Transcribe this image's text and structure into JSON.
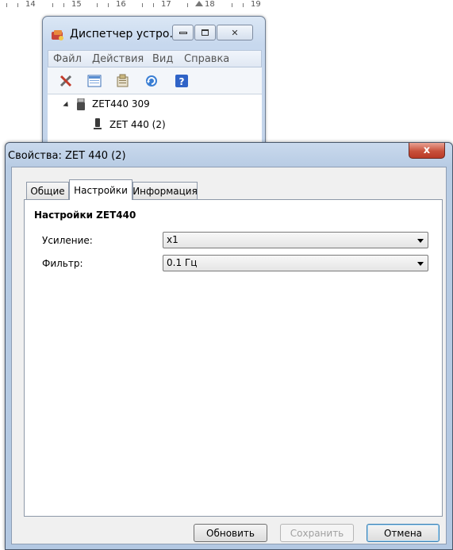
{
  "ruler": {
    "labels": [
      "14",
      "15",
      "16",
      "17",
      "18",
      "19"
    ]
  },
  "device_manager": {
    "title": "Диспетчер устро...",
    "menu": [
      "Файл",
      "Действия",
      "Вид",
      "Справка"
    ],
    "toolbar_icons": [
      "properties-icon",
      "view-icon",
      "update-driver-icon",
      "scan-hardware-icon",
      "help-icon"
    ],
    "tree": {
      "root": "ZET440 309",
      "child": "ZET 440 (2)"
    }
  },
  "dialog": {
    "title": "Свойства: ZET 440 (2)",
    "close_glyph": "x",
    "tabs": [
      "Общие",
      "Настройки",
      "Информация"
    ],
    "active_tab": "Настройки",
    "section_title": "Настройки ZET440",
    "fields": [
      {
        "label": "Усиление:",
        "value": "x1"
      },
      {
        "label": "Фильтр:",
        "value": "0.1 Гц"
      }
    ],
    "buttons": {
      "refresh": "Обновить",
      "save": "Сохранить",
      "cancel": "Отмена"
    }
  },
  "colors": {
    "title_bar": "#c7d8ee",
    "close_button": "#c8503b",
    "default_button_border": "#3c7fb1"
  }
}
